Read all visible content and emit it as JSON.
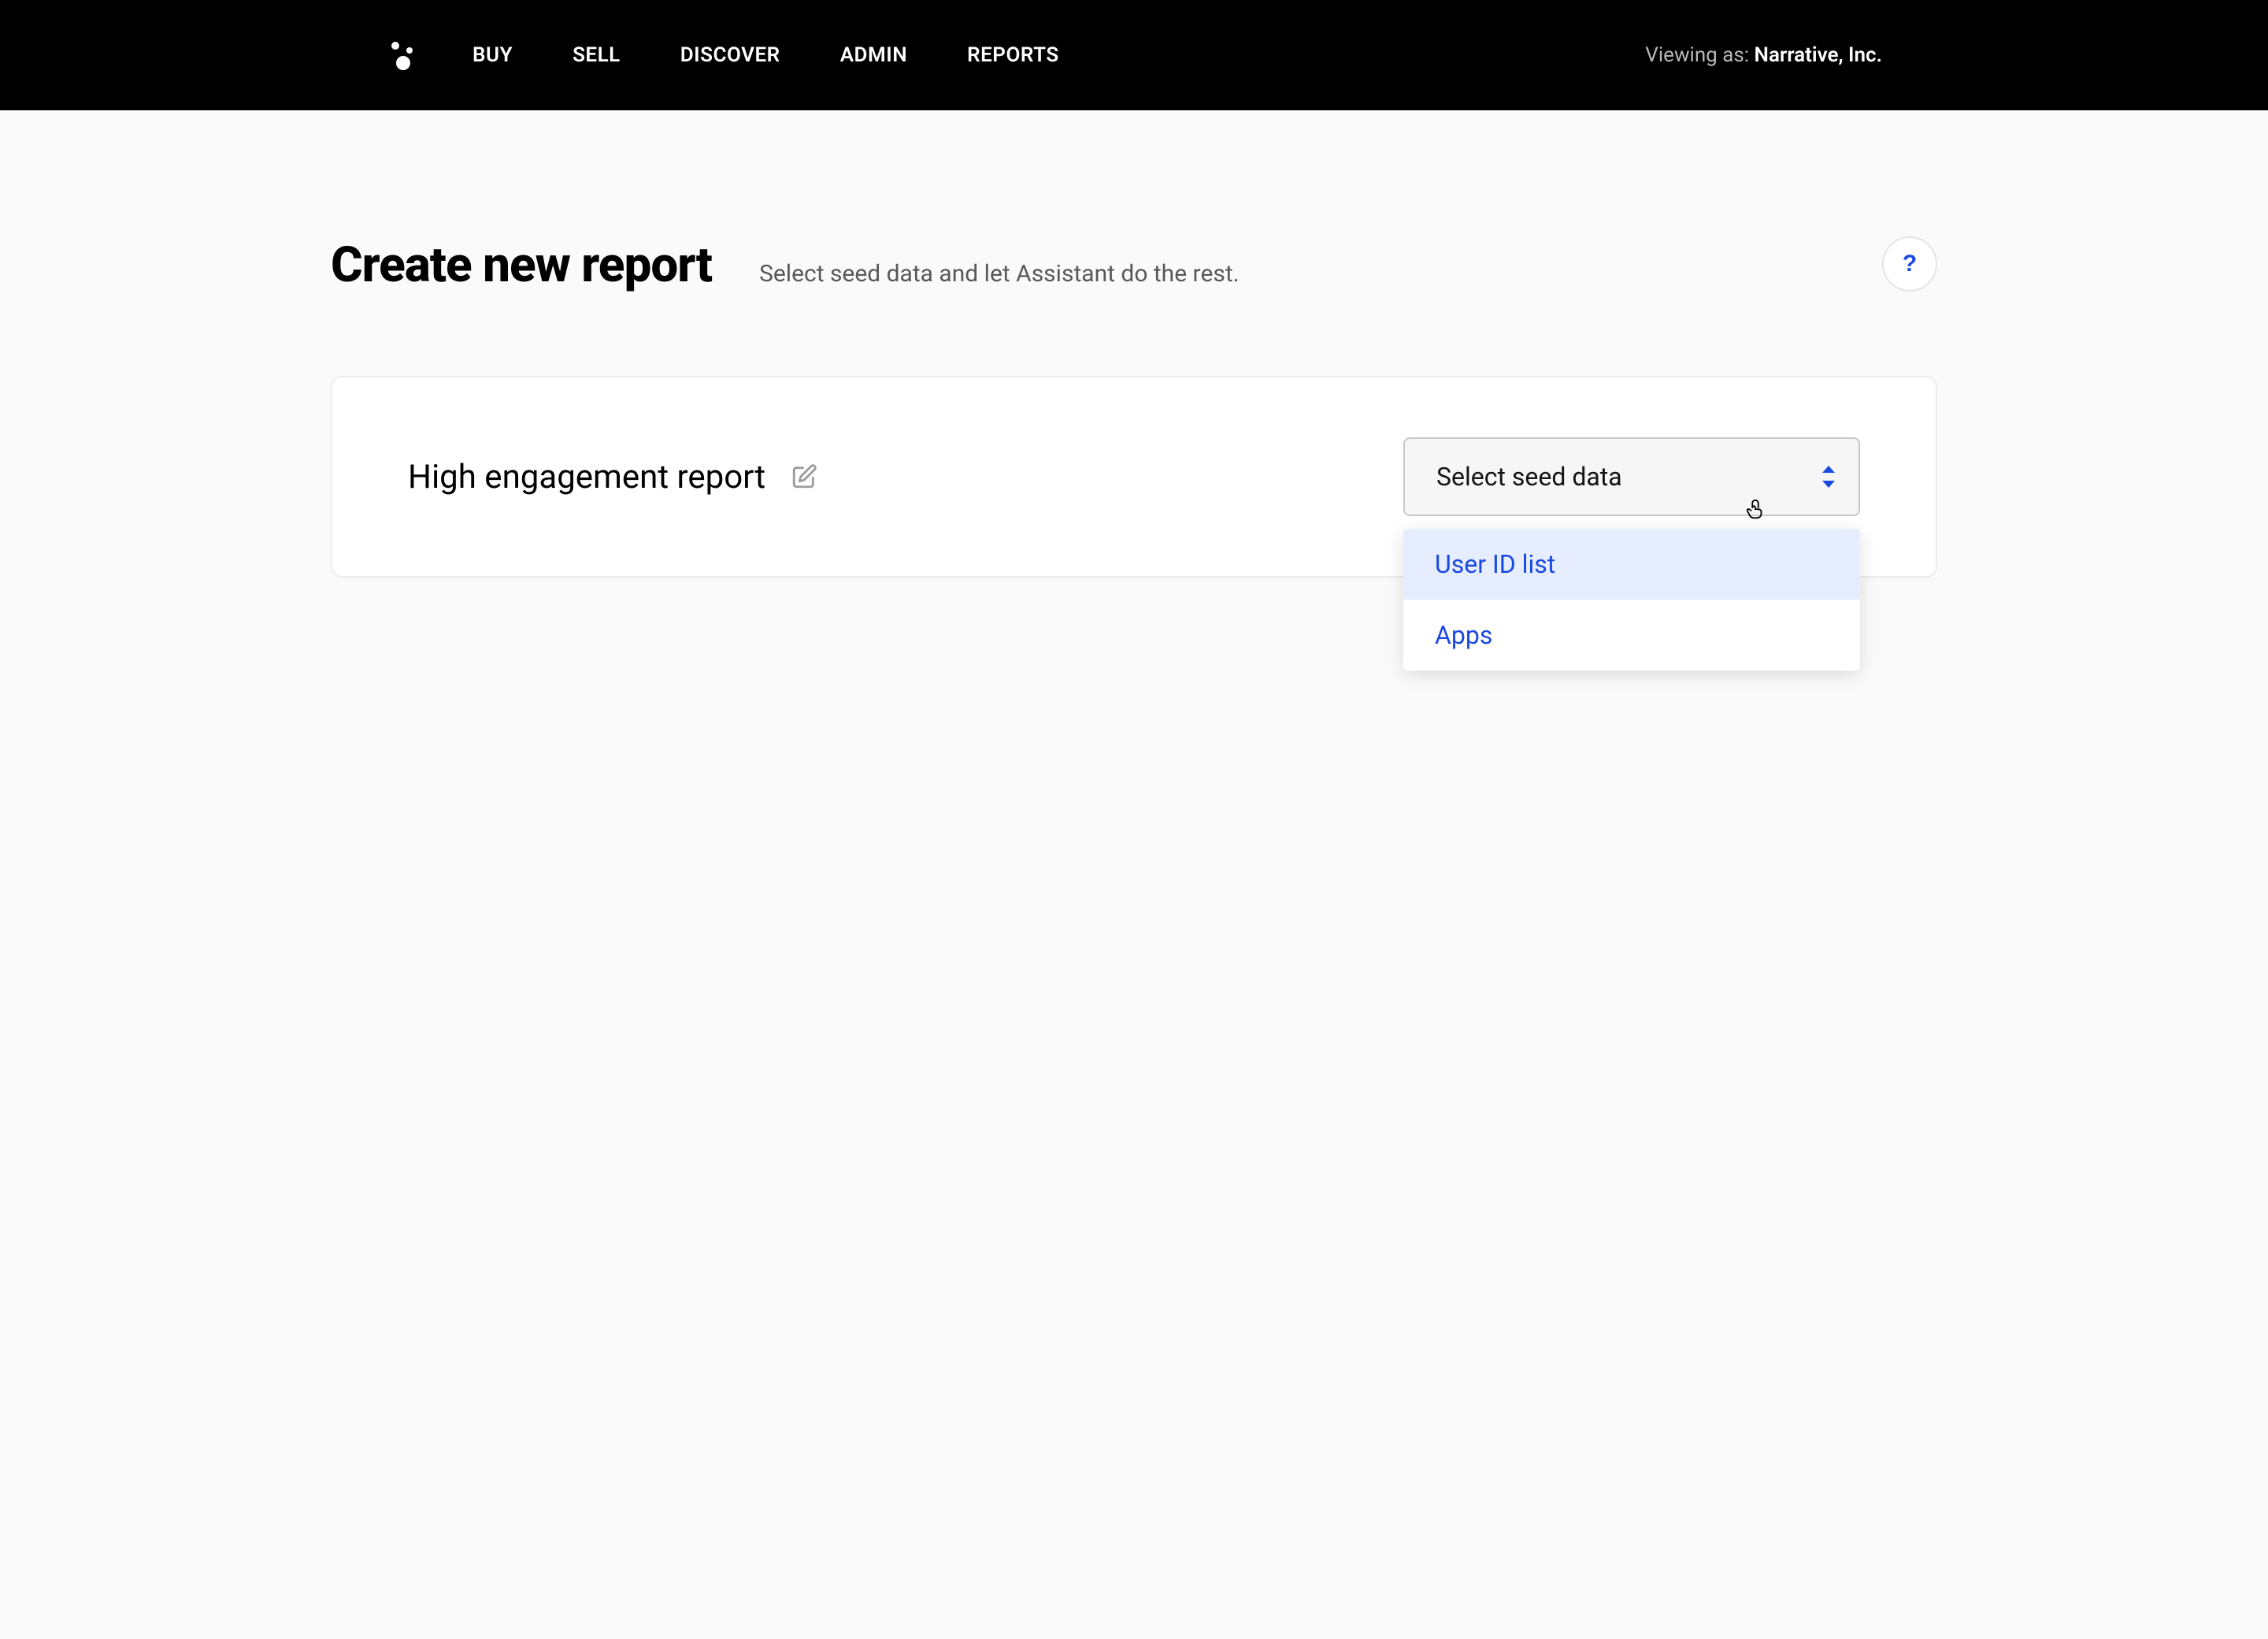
{
  "nav": {
    "items": [
      "BUY",
      "SELL",
      "DISCOVER",
      "ADMIN",
      "REPORTS"
    ]
  },
  "viewing": {
    "label": "Viewing as: ",
    "org": "Narrative, Inc."
  },
  "header": {
    "title": "Create new report",
    "subtitle": "Select seed data and let Assistant do the rest.",
    "help": "?"
  },
  "card": {
    "report_name": "High engagement report",
    "select_placeholder": "Select seed data",
    "options": [
      "User ID list",
      "Apps"
    ]
  }
}
